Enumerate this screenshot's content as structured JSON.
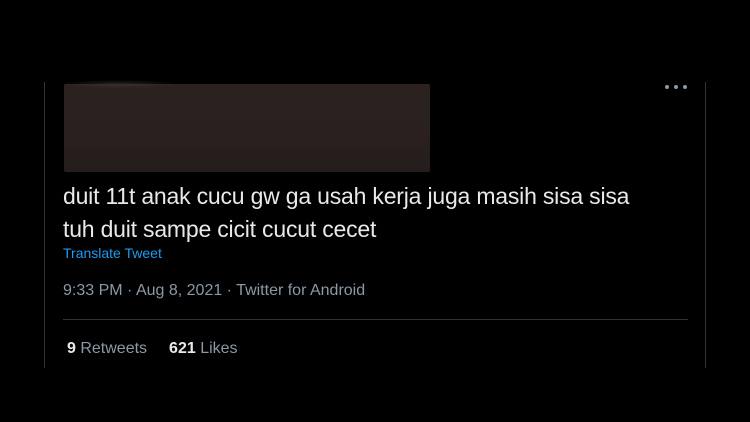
{
  "tweet": {
    "text_line1": "duit 11t anak cucu gw ga usah kerja juga masih sisa sisa",
    "text_line2": "tuh duit sampe cicit cucut cecet",
    "translate_label": "Translate Tweet",
    "time": "9:33 PM",
    "date": "Aug 8, 2021",
    "source": "Twitter for Android",
    "separator": " · ",
    "more_icon": "more-horizontal-icon"
  },
  "stats": {
    "retweets_count": "9",
    "retweets_label": " Retweets",
    "likes_count": "621",
    "likes_label": " Likes"
  },
  "colors": {
    "background": "#000000",
    "text": "#e7e9ea",
    "muted": "#8b98a5",
    "link": "#1d9bf0",
    "border": "#2f3336"
  }
}
